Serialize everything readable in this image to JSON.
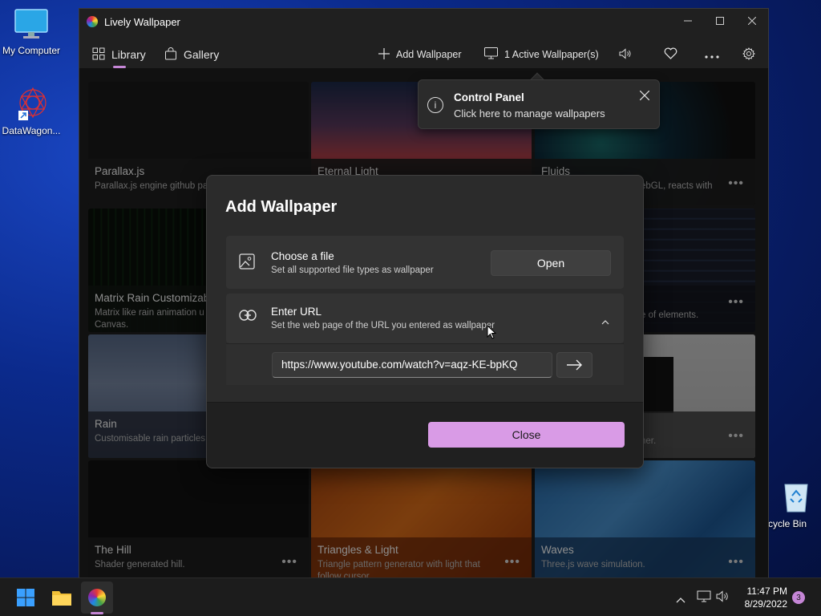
{
  "desktop": {
    "icons": [
      {
        "label": "My Computer"
      },
      {
        "label": "DataWagon..."
      },
      {
        "label": "cycle Bin"
      }
    ]
  },
  "window": {
    "title": "Lively Wallpaper"
  },
  "nav": {
    "library": "Library",
    "gallery": "Gallery",
    "add_wallpaper": "Add Wallpaper",
    "active_wallpapers": "1 Active Wallpaper(s)"
  },
  "tiles": [
    {
      "name": "Parallax.js",
      "desc": "Parallax.js engine github pa"
    },
    {
      "name": "Eternal Light",
      "desc": ""
    },
    {
      "name": "Fluids",
      "desc": "ebGL, reacts with"
    },
    {
      "name": "Matrix Rain Customizab",
      "desc": "Matrix like rain animation u",
      "desc2": "Canvas."
    },
    {
      "name": "",
      "desc": ""
    },
    {
      "name": "",
      "desc": "e of elements."
    },
    {
      "name": "Rain",
      "desc": "Customisable rain particles"
    },
    {
      "name": "",
      "desc": ""
    },
    {
      "name": "",
      "desc": "her."
    },
    {
      "name": "The Hill",
      "desc": "Shader generated hill."
    },
    {
      "name": "Triangles & Light",
      "desc": "Triangle pattern generator with light that",
      "desc2": "follow cursor."
    },
    {
      "name": "Waves",
      "desc": "Three.js wave simulation."
    }
  ],
  "toast": {
    "title": "Control Panel",
    "message": "Click here to manage wallpapers"
  },
  "dialog": {
    "title": "Add Wallpaper",
    "file": {
      "title": "Choose a file",
      "desc": "Set all supported file types as wallpaper",
      "button": "Open"
    },
    "url": {
      "title": "Enter URL",
      "desc": "Set the web page of the URL you entered as wallpaper",
      "value": "https://www.youtube.com/watch?v=aqz-KE-bpKQ"
    },
    "close": "Close"
  },
  "taskbar": {
    "time": "11:47 PM",
    "date": "8/29/2022",
    "notifications": "3"
  },
  "colors": {
    "accent": "#d99be6",
    "window_bg": "#202020",
    "dialog_bg": "#2b2b2b"
  }
}
